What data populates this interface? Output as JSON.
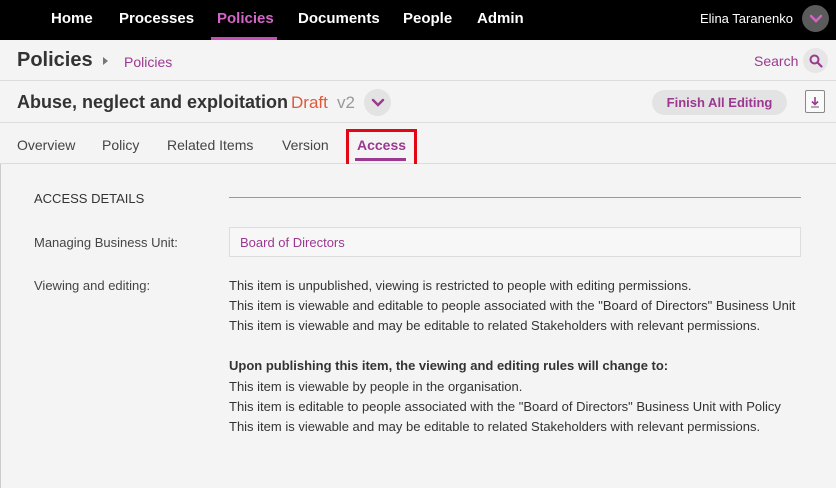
{
  "nav": {
    "items": [
      {
        "label": "Home",
        "active": false
      },
      {
        "label": "Processes",
        "active": false
      },
      {
        "label": "Policies",
        "active": true
      },
      {
        "label": "Documents",
        "active": false
      },
      {
        "label": "People",
        "active": false
      },
      {
        "label": "Admin",
        "active": false
      }
    ],
    "user_name": "Elina Taranenko"
  },
  "header": {
    "title": "Policies",
    "breadcrumb": "Policies",
    "search_label": "Search"
  },
  "item": {
    "title": "Abuse, neglect and exploitation",
    "status": "Draft",
    "version": "v2",
    "finish_label": "Finish All Editing"
  },
  "tabs": [
    {
      "label": "Overview",
      "active": false
    },
    {
      "label": "Policy",
      "active": false
    },
    {
      "label": "Related Items",
      "active": false
    },
    {
      "label": "Version",
      "active": false
    },
    {
      "label": "Access",
      "active": true
    }
  ],
  "access": {
    "section_title": "ACCESS DETAILS",
    "managing_label": "Managing Business Unit:",
    "managing_value": "Board of Directors",
    "viewing_label": "Viewing and editing:",
    "current_rules": [
      "This item is unpublished, viewing is restricted to people with editing permissions.",
      "This item is viewable and editable to people associated with the \"Board of Directors\" Business Unit",
      "This item is viewable and may be editable to related Stakeholders with relevant permissions."
    ],
    "publish_heading": "Upon publishing this item, the viewing and editing rules will change to:",
    "publish_rules": [
      "This item is viewable by people in the organisation.",
      "This item is editable to people associated with the \"Board of Directors\" Business Unit with Policy",
      "This item is viewable and may be editable to related Stakeholders with relevant permissions."
    ]
  },
  "colors": {
    "accent": "#9b3990",
    "nav_active": "#d465c8",
    "draft": "#e05a3a",
    "highlight": "#e30613"
  }
}
